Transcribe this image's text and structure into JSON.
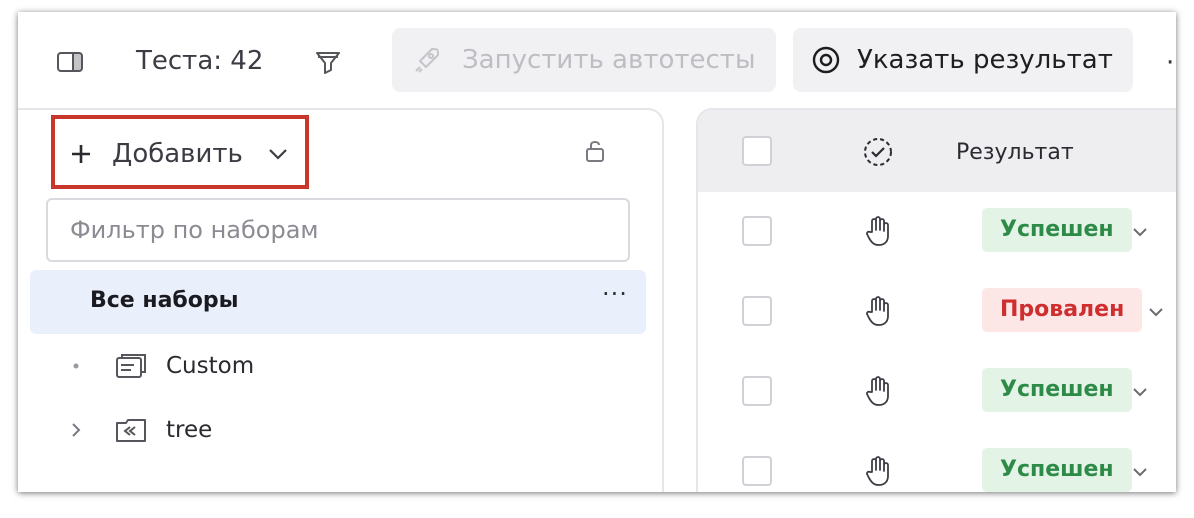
{
  "toolbar": {
    "test_count": "Теста: 42",
    "run_autotests_label": "Запустить автотесты",
    "set_result_label": "Указать результат",
    "more_label": "·"
  },
  "sidebar": {
    "add_label": "Добавить",
    "filter_placeholder": "Фильтр по наборам",
    "all_sets_label": "Все наборы",
    "all_sets_more": "···",
    "items": [
      {
        "label": "Custom",
        "expander": "dot",
        "icon": "suite-icon"
      },
      {
        "label": "tree",
        "expander": "chevron-right",
        "icon": "shared-steps-icon"
      }
    ]
  },
  "table": {
    "header_result": "Результат",
    "rows": [
      {
        "status": "Успешен",
        "kind": "pass"
      },
      {
        "status": "Провален",
        "kind": "fail"
      },
      {
        "status": "Успешен",
        "kind": "pass"
      },
      {
        "status": "Успешен",
        "kind": "pass"
      }
    ]
  },
  "colors": {
    "accent_highlight": "#c9372c",
    "pass_bg": "#e3f4e6",
    "pass_text": "#2e8a47",
    "fail_bg": "#fde6e6",
    "fail_text": "#cf2e2e",
    "selected_bg": "#eaf0fb"
  }
}
